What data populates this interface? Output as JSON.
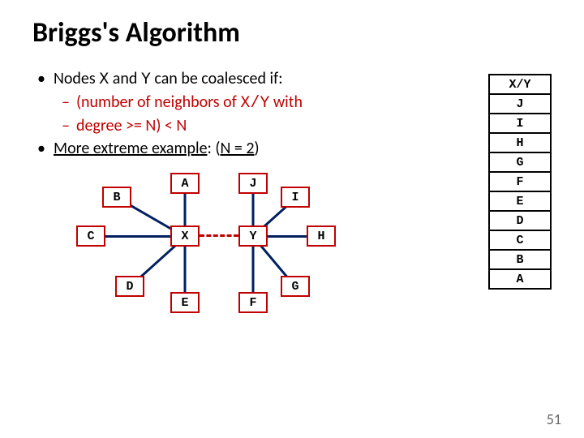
{
  "title": "Briggs's Algorithm",
  "bullets": {
    "b1_pre": "Nodes ",
    "b1_x": "X",
    "b1_mid": " and ",
    "b1_y": "Y",
    "b1_post": " can be coalesced if:",
    "sub1_pre": "(number of neighbors of ",
    "sub1_xy": "X/Y",
    "sub1_post": " with",
    "sub2": "degree >= N) < N",
    "b2_pre": "More extreme example",
    "b2_post": ": (",
    "b2_eq": "N = 2",
    "b2_close": ")"
  },
  "nodes": {
    "A": "A",
    "B": "B",
    "C": "C",
    "D": "D",
    "E": "E",
    "F": "F",
    "G": "G",
    "H": "H",
    "I": "I",
    "J": "J",
    "X": "X",
    "Y": "Y"
  },
  "stack": [
    "X/Y",
    "J",
    "I",
    "H",
    "G",
    "F",
    "E",
    "D",
    "C",
    "B",
    "A"
  ],
  "pagenum": "51"
}
